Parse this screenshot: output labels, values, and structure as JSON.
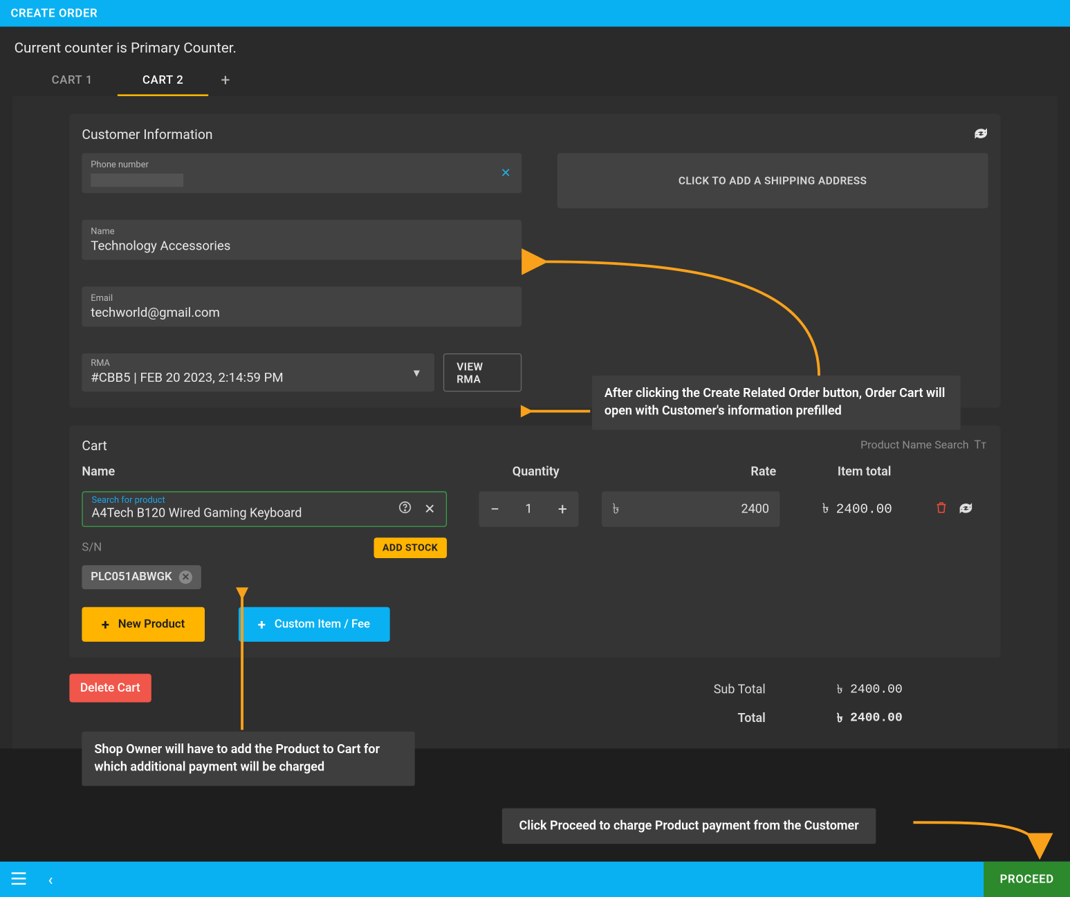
{
  "header": {
    "title": "CREATE ORDER"
  },
  "counter_line": "Current counter is Primary Counter.",
  "tabs": {
    "cart1": "CART 1",
    "cart2": "CART 2"
  },
  "customer": {
    "section_title": "Customer Information",
    "phone_label": "Phone number",
    "name_label": "Name",
    "name_value": "Technology Accessories",
    "email_label": "Email",
    "email_value": "techworld@gmail.com",
    "rma_label": "RMA",
    "rma_value": "#CBB5 | FEB 20 2023, 2:14:59 PM",
    "view_rma": "VIEW RMA",
    "ship_btn": "CLICK TO ADD A SHIPPING ADDRESS"
  },
  "cart": {
    "title": "Cart",
    "search_hint": "Product Name Search",
    "columns": {
      "name": "Name",
      "qty": "Quantity",
      "rate": "Rate",
      "total": "Item total"
    },
    "search_label": "Search for product",
    "product_name": "A4Tech B120 Wired Gaming Keyboard",
    "qty": "1",
    "rate": "2400",
    "item_total": "2400.00",
    "sn_label": "S/N",
    "add_stock": "ADD STOCK",
    "sn_value": "PLC051ABWGK",
    "new_product": "New Product",
    "custom_item": "Custom Item / Fee"
  },
  "totals": {
    "subtotal_label": "Sub Total",
    "subtotal_value": "2400.00",
    "total_label": "Total",
    "total_value": "2400.00"
  },
  "currency": "৳",
  "delete_cart": "Delete Cart",
  "proceed": "PROCEED",
  "callouts": {
    "c1": "After clicking the Create Related Order button, Order Cart will open with Customer's information prefilled",
    "c2": "Shop Owner will have to add the Product to Cart for which additional payment will be charged",
    "c3": "Click Proceed to charge Product payment from the Customer"
  }
}
